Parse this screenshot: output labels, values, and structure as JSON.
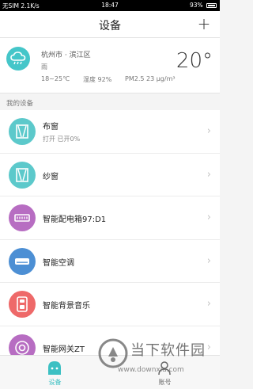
{
  "status_bar": {
    "carrier": "无SIM 2.1K/s",
    "time": "18:47",
    "battery": "93%"
  },
  "header": {
    "title": "设备",
    "add_label": "+"
  },
  "weather": {
    "location": "杭州市 · 滨江区",
    "condition": "雨",
    "temp_range": "18~25℃",
    "humidity": "湿度 92%",
    "pm": "PM2.5 23 μg/m³",
    "temperature": "20°",
    "icon": "rain-cloud-icon"
  },
  "section": {
    "label": "我的设备"
  },
  "devices": [
    {
      "name": "布窗",
      "status": "打开   已开0%",
      "icon": "curtain-icon",
      "color": "#5cc9cb"
    },
    {
      "name": "纱窗",
      "icon": "screen-window-icon",
      "color": "#5cc9cb"
    },
    {
      "name": "智能配电箱97:D1",
      "icon": "distribution-box-icon",
      "color": "#b76dc2"
    },
    {
      "name": "智能空调",
      "icon": "air-conditioner-icon",
      "color": "#4c8fd4"
    },
    {
      "name": "智能背景音乐",
      "icon": "speaker-icon",
      "color": "#ee6969"
    },
    {
      "name": "智能网关ZT",
      "icon": "gateway-icon",
      "color": "#b76dc2"
    }
  ],
  "tabs": [
    {
      "label": "设备",
      "icon": "device-tab-icon",
      "active": true
    },
    {
      "label": "账号",
      "icon": "account-tab-icon",
      "active": false
    }
  ],
  "watermark": {
    "text": "当下软件园",
    "url": "www.downxia.com"
  },
  "colors": {
    "accent": "#3cc0c3",
    "purple": "#b76dc2",
    "blue": "#4c8fd4",
    "red": "#ee6969"
  }
}
